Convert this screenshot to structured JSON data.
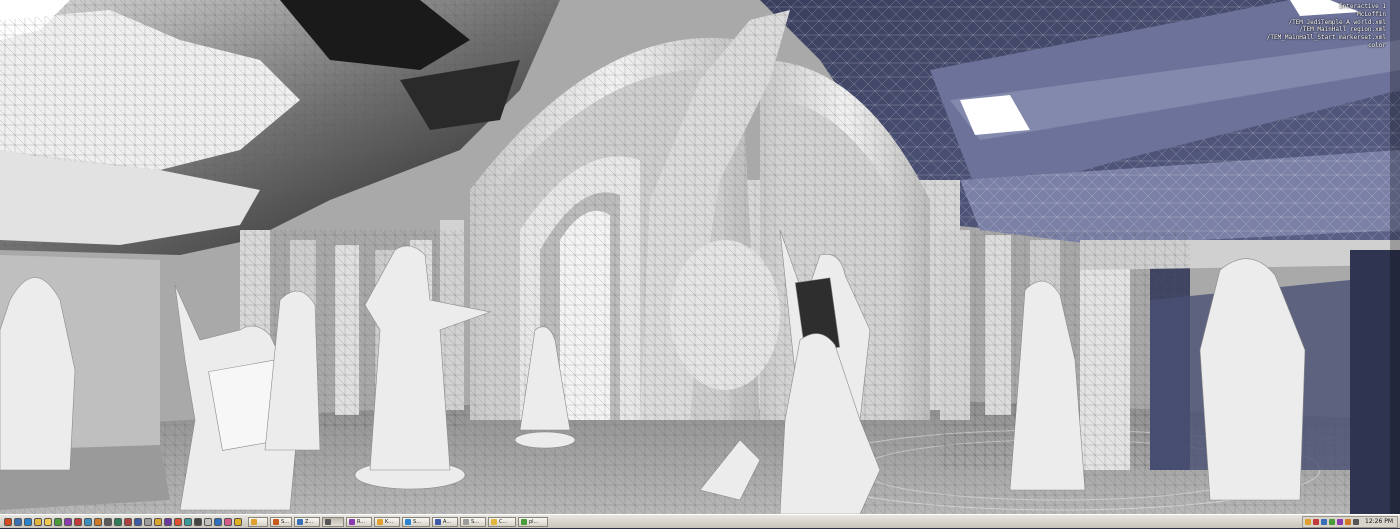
{
  "viewport": {
    "overlay_lines": [
      "Interactive 1",
      "McLoffin",
      "/TEM_JediTemple_A world.xml",
      "/TEM_MainHall region.xml",
      "/TEM_MainHall_Start markerset.xml",
      "color"
    ]
  },
  "taskbar": {
    "quick_launch": [
      {
        "icon": "start-icon",
        "color": "#d44a1e"
      },
      {
        "icon": "desktop-icon",
        "color": "#3a6fb5"
      },
      {
        "icon": "browser-icon",
        "color": "#2b83d0"
      },
      {
        "icon": "mail-icon",
        "color": "#e3b53c"
      },
      {
        "icon": "explorer-icon",
        "color": "#f0c850"
      },
      {
        "icon": "media-icon",
        "color": "#4a9b3a"
      },
      {
        "icon": "app-icon",
        "color": "#8a3bb0"
      },
      {
        "icon": "app-icon",
        "color": "#c23a3a"
      },
      {
        "icon": "app-icon",
        "color": "#3b8fbf"
      },
      {
        "icon": "app-icon",
        "color": "#d07a28"
      },
      {
        "icon": "app-icon",
        "color": "#5a5a5a"
      },
      {
        "icon": "app-icon",
        "color": "#2e7d5a"
      },
      {
        "icon": "app-icon",
        "color": "#b04040"
      },
      {
        "icon": "app-icon",
        "color": "#3c5aa8"
      },
      {
        "icon": "app-icon",
        "color": "#9c9c9c"
      },
      {
        "icon": "app-icon",
        "color": "#d9a52a"
      },
      {
        "icon": "app-icon",
        "color": "#6a3aa0"
      },
      {
        "icon": "app-icon",
        "color": "#e05030"
      },
      {
        "icon": "app-icon",
        "color": "#3a9a9a"
      },
      {
        "icon": "app-icon",
        "color": "#444444"
      },
      {
        "icon": "app-icon",
        "color": "#c0c0c0"
      },
      {
        "icon": "app-icon",
        "color": "#2f6fc0"
      },
      {
        "icon": "app-icon",
        "color": "#d85a8a"
      },
      {
        "icon": "app-icon",
        "color": "#e0b020"
      }
    ],
    "tasks": [
      {
        "label": "",
        "color": "#e0a030"
      },
      {
        "label": "S...",
        "color": "#c85a1e"
      },
      {
        "label": "Z...",
        "color": "#3a6fb5"
      },
      {
        "label": "",
        "color": "#555555",
        "active": true
      },
      {
        "label": "R...",
        "color": "#8a3bb0"
      },
      {
        "label": "K...",
        "color": "#e0a030"
      },
      {
        "label": "S...",
        "color": "#2b83d0"
      },
      {
        "label": "A...",
        "color": "#3c5aa8"
      },
      {
        "label": "S...",
        "color": "#9c9c9c"
      },
      {
        "label": "C...",
        "color": "#e3b53c"
      },
      {
        "label": "pl...",
        "color": "#4a9b3a"
      }
    ],
    "tray_icons": [
      {
        "icon": "tray-icon",
        "color": "#e0a030"
      },
      {
        "icon": "tray-icon",
        "color": "#c23a3a"
      },
      {
        "icon": "tray-icon",
        "color": "#3a6fb5"
      },
      {
        "icon": "tray-icon",
        "color": "#4a9b3a"
      },
      {
        "icon": "tray-icon",
        "color": "#8a3bb0"
      },
      {
        "icon": "tray-icon",
        "color": "#d07a28"
      },
      {
        "icon": "tray-icon",
        "color": "#555555"
      }
    ],
    "clock": "12:26 PM"
  }
}
